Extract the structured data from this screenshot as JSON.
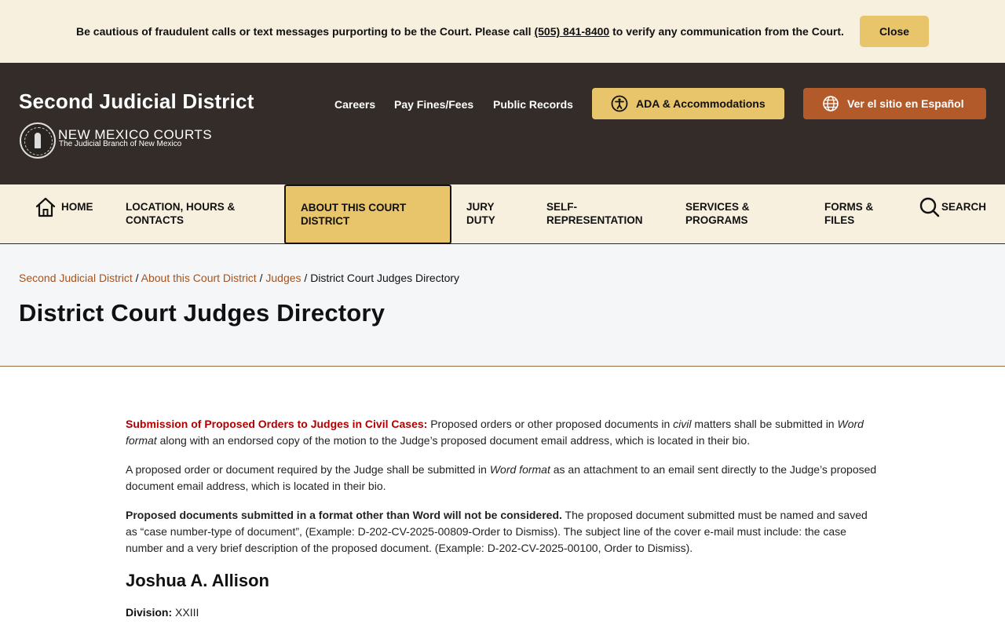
{
  "alert": {
    "text_before": "Be cautious of fraudulent calls or text messages purporting to be the Court. Please call ",
    "phone": "(505) 841-8400",
    "text_after": " to verify any communication from the Court.",
    "close_label": "Close"
  },
  "header": {
    "site_title": "Second Judicial District",
    "logo_title": "NEW MEXICO COURTS",
    "logo_subtitle": "The Judicial Branch of New Mexico",
    "links": [
      "Careers",
      "Pay Fines/Fees",
      "Public Records"
    ],
    "ada_label": "ADA & Accommodations",
    "spanish_label": "Ver el sitio en Español"
  },
  "nav": {
    "home": "HOME",
    "location_line1": "LOCATION, HOURS &",
    "location_line2": "CONTACTS",
    "about_line1": "ABOUT THIS COURT",
    "about_line2": "DISTRICT",
    "jury_line1": "JURY",
    "jury_line2": "DUTY",
    "self_line1": "SELF-",
    "self_line2": "REPRESENTATION",
    "services_line1": "SERVICES &",
    "services_line2": "PROGRAMS",
    "forms_line1": "FORMS &",
    "forms_line2": "FILES",
    "search": "SEARCH"
  },
  "breadcrumb": {
    "items": [
      "Second Judicial District",
      "About this Court District",
      "Judges"
    ],
    "current": "District Court Judges Directory",
    "separator": " / "
  },
  "page": {
    "title": "District Court Judges Directory"
  },
  "content": {
    "p1_lead": "Submission of Proposed Orders to Judges in Civil Cases:",
    "p1_a": " Proposed orders or other proposed documents in ",
    "p1_civil": "civil",
    "p1_b": " matters shall be submitted in ",
    "p1_word": "Word format",
    "p1_c": " along with an endorsed copy of the motion to the Judge’s proposed document email address, which is located in their bio.",
    "p2_a": "A proposed order or document required by the Judge shall be submitted in ",
    "p2_word": "Word format",
    "p2_b": " as an attachment to an email sent directly to the Judge’s proposed document email address, which is located in their bio.",
    "p3_bold": "Proposed documents submitted in a format other than Word will not be considered.",
    "p3_rest": " The proposed document submitted must be named and saved as “case number-type of document”, (Example: D-202-CV-2025-00809-Order to Dismiss). The subject line of the cover e-mail must include: the case number and a very brief description of the proposed document. (Example: D-202-CV-2025-00100, Order to Dismiss).",
    "judge_name": "Joshua A. Allison",
    "division_label": "Division:",
    "division_value": " XXIII"
  },
  "colors": {
    "banner_bg": "#f8f0de",
    "header_bg": "#332c28",
    "gold": "#e8c46a",
    "rust": "#b35a2a",
    "link": "#a5531f",
    "alert_red": "#b00000"
  }
}
